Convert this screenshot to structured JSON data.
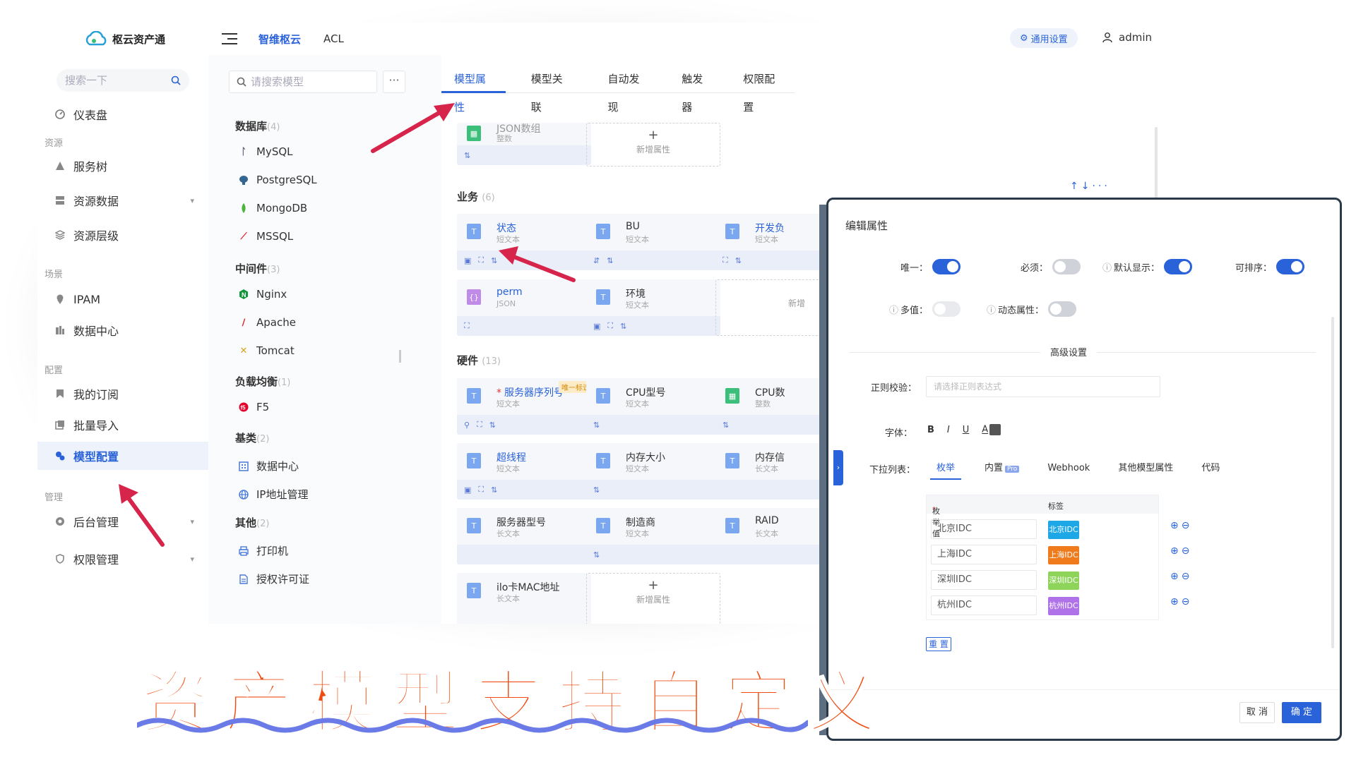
{
  "app": {
    "name": "枢云资产通",
    "nav_primary": "智维枢云",
    "nav_secondary": "ACL",
    "settings_label": "通用设置",
    "user": "admin"
  },
  "sidebar": {
    "search_placeholder": "搜索一下",
    "dashboard": "仪表盘",
    "groups": {
      "resource": "资源",
      "scene": "场景",
      "config": "配置",
      "manage": "管理"
    },
    "items": {
      "service_tree": "服务树",
      "resource_data": "资源数据",
      "resource_level": "资源层级",
      "ipam": "IPAM",
      "datacenter": "数据中心",
      "subscription": "我的订阅",
      "batch_import": "批量导入",
      "model_config": "模型配置",
      "backend": "后台管理",
      "permission": "权限管理"
    }
  },
  "models": {
    "search_placeholder": "请搜索模型",
    "more": "···",
    "cats": [
      {
        "name": "数据库",
        "count": "(4)",
        "items": [
          "MySQL",
          "PostgreSQL",
          "MongoDB",
          "MSSQL"
        ]
      },
      {
        "name": "中间件",
        "count": "(3)",
        "items": [
          "Nginx",
          "Apache",
          "Tomcat"
        ]
      },
      {
        "name": "负载均衡",
        "count": "(1)",
        "items": [
          "F5"
        ]
      },
      {
        "name": "基类",
        "count": "(2)",
        "items": [
          "数据中心",
          "IP地址管理"
        ]
      },
      {
        "name": "其他",
        "count": "(2)",
        "items": [
          "打印机",
          "授权许可证"
        ]
      }
    ]
  },
  "tabs": [
    "模型属性",
    "模型关联",
    "自动发现",
    "触发器",
    "权限配置"
  ],
  "groups": {
    "business": {
      "name": "业务",
      "count": "(6)"
    },
    "hardware": {
      "name": "硬件",
      "count": "(13)"
    }
  },
  "cards": {
    "top": {
      "name": "JSON数组",
      "type": "整数"
    },
    "status": {
      "name": "状态",
      "type": "短文本"
    },
    "bu": {
      "name": "BU",
      "type": "短文本"
    },
    "dev": {
      "name": "开发负",
      "type": "短文本"
    },
    "perm": {
      "name": "perm",
      "type": "JSON"
    },
    "env": {
      "name": "环境",
      "type": "短文本"
    },
    "sn": {
      "name": "服务器序列号",
      "type": "短文本",
      "badge": "唯一标识"
    },
    "cpu_model": {
      "name": "CPU型号",
      "type": "短文本"
    },
    "cpu_count": {
      "name": "CPU数",
      "type": "整数"
    },
    "ht": {
      "name": "超线程",
      "type": "短文本"
    },
    "mem": {
      "name": "内存大小",
      "type": "短文本"
    },
    "mem2": {
      "name": "内存信",
      "type": "长文本"
    },
    "server_model": {
      "name": "服务器型号",
      "type": "长文本"
    },
    "vendor": {
      "name": "制造商",
      "type": "短文本"
    },
    "raid": {
      "name": "RAID",
      "type": "长文本"
    },
    "ilo": {
      "name": "ilo卡MAC地址",
      "type": "长文本"
    }
  },
  "add_attr": "新增属性",
  "add_attr_short": "新增",
  "modal": {
    "title": "编辑属性",
    "unique": "唯一：",
    "required": "必须：",
    "default_show": "默认显示：",
    "sortable": "可排序：",
    "multi": "多值：",
    "dynamic": "动态属性：",
    "advanced": "高级设置",
    "regex_label": "正则校验：",
    "regex_placeholder": "请选择正则表达式",
    "font_label": "字体：",
    "font_b": "B",
    "font_i": "I",
    "font_u": "U",
    "font_a": "A",
    "dropdown_label": "下拉列表：",
    "dd_tabs": [
      "枚举",
      "内置",
      "Webhook",
      "其他模型属性",
      "代码"
    ],
    "pro": "Pro",
    "table_head_value": "枚举值",
    "table_head_tag": "标签",
    "rows": [
      {
        "value": "北京IDC",
        "tag": "北京IDC"
      },
      {
        "value": "上海IDC",
        "tag": "上海IDC"
      },
      {
        "value": "深圳IDC",
        "tag": "深圳IDC"
      },
      {
        "value": "杭州IDC",
        "tag": "杭州IDC"
      }
    ],
    "reset": "重 置",
    "cancel": "取 消",
    "ok": "确 定"
  },
  "banner": "资产模型支持自定义",
  "colors": {
    "accent": "#2a62d9",
    "banner": "#f24b0f",
    "arrow": "#d6244a",
    "tag_bj": "#1ea7e6",
    "tag_sh": "#f07b1d",
    "tag_sz": "#8fd45a",
    "tag_hz": "#b072e8"
  }
}
